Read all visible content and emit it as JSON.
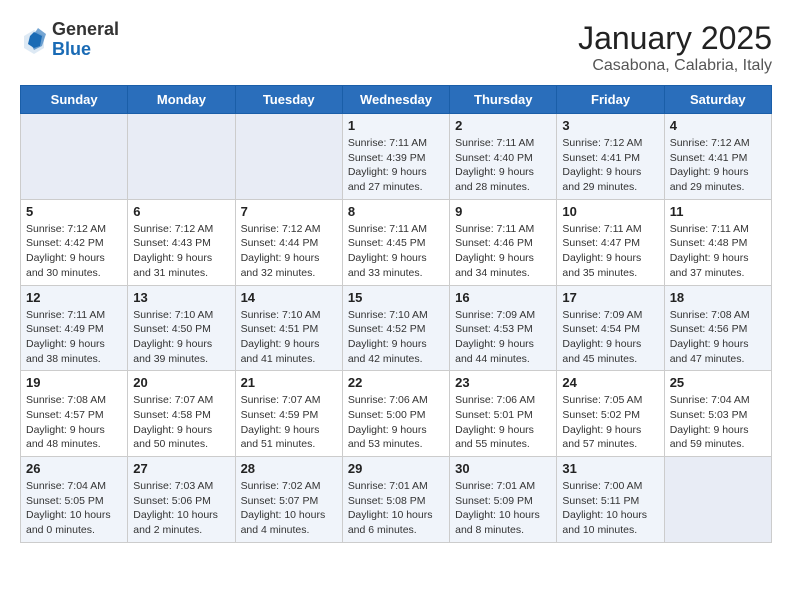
{
  "header": {
    "logo_general": "General",
    "logo_blue": "Blue",
    "month": "January 2025",
    "location": "Casabona, Calabria, Italy"
  },
  "weekdays": [
    "Sunday",
    "Monday",
    "Tuesday",
    "Wednesday",
    "Thursday",
    "Friday",
    "Saturday"
  ],
  "weeks": [
    [
      {
        "day": "",
        "info": ""
      },
      {
        "day": "",
        "info": ""
      },
      {
        "day": "",
        "info": ""
      },
      {
        "day": "1",
        "info": "Sunrise: 7:11 AM\nSunset: 4:39 PM\nDaylight: 9 hours\nand 27 minutes."
      },
      {
        "day": "2",
        "info": "Sunrise: 7:11 AM\nSunset: 4:40 PM\nDaylight: 9 hours\nand 28 minutes."
      },
      {
        "day": "3",
        "info": "Sunrise: 7:12 AM\nSunset: 4:41 PM\nDaylight: 9 hours\nand 29 minutes."
      },
      {
        "day": "4",
        "info": "Sunrise: 7:12 AM\nSunset: 4:41 PM\nDaylight: 9 hours\nand 29 minutes."
      }
    ],
    [
      {
        "day": "5",
        "info": "Sunrise: 7:12 AM\nSunset: 4:42 PM\nDaylight: 9 hours\nand 30 minutes."
      },
      {
        "day": "6",
        "info": "Sunrise: 7:12 AM\nSunset: 4:43 PM\nDaylight: 9 hours\nand 31 minutes."
      },
      {
        "day": "7",
        "info": "Sunrise: 7:12 AM\nSunset: 4:44 PM\nDaylight: 9 hours\nand 32 minutes."
      },
      {
        "day": "8",
        "info": "Sunrise: 7:11 AM\nSunset: 4:45 PM\nDaylight: 9 hours\nand 33 minutes."
      },
      {
        "day": "9",
        "info": "Sunrise: 7:11 AM\nSunset: 4:46 PM\nDaylight: 9 hours\nand 34 minutes."
      },
      {
        "day": "10",
        "info": "Sunrise: 7:11 AM\nSunset: 4:47 PM\nDaylight: 9 hours\nand 35 minutes."
      },
      {
        "day": "11",
        "info": "Sunrise: 7:11 AM\nSunset: 4:48 PM\nDaylight: 9 hours\nand 37 minutes."
      }
    ],
    [
      {
        "day": "12",
        "info": "Sunrise: 7:11 AM\nSunset: 4:49 PM\nDaylight: 9 hours\nand 38 minutes."
      },
      {
        "day": "13",
        "info": "Sunrise: 7:10 AM\nSunset: 4:50 PM\nDaylight: 9 hours\nand 39 minutes."
      },
      {
        "day": "14",
        "info": "Sunrise: 7:10 AM\nSunset: 4:51 PM\nDaylight: 9 hours\nand 41 minutes."
      },
      {
        "day": "15",
        "info": "Sunrise: 7:10 AM\nSunset: 4:52 PM\nDaylight: 9 hours\nand 42 minutes."
      },
      {
        "day": "16",
        "info": "Sunrise: 7:09 AM\nSunset: 4:53 PM\nDaylight: 9 hours\nand 44 minutes."
      },
      {
        "day": "17",
        "info": "Sunrise: 7:09 AM\nSunset: 4:54 PM\nDaylight: 9 hours\nand 45 minutes."
      },
      {
        "day": "18",
        "info": "Sunrise: 7:08 AM\nSunset: 4:56 PM\nDaylight: 9 hours\nand 47 minutes."
      }
    ],
    [
      {
        "day": "19",
        "info": "Sunrise: 7:08 AM\nSunset: 4:57 PM\nDaylight: 9 hours\nand 48 minutes."
      },
      {
        "day": "20",
        "info": "Sunrise: 7:07 AM\nSunset: 4:58 PM\nDaylight: 9 hours\nand 50 minutes."
      },
      {
        "day": "21",
        "info": "Sunrise: 7:07 AM\nSunset: 4:59 PM\nDaylight: 9 hours\nand 51 minutes."
      },
      {
        "day": "22",
        "info": "Sunrise: 7:06 AM\nSunset: 5:00 PM\nDaylight: 9 hours\nand 53 minutes."
      },
      {
        "day": "23",
        "info": "Sunrise: 7:06 AM\nSunset: 5:01 PM\nDaylight: 9 hours\nand 55 minutes."
      },
      {
        "day": "24",
        "info": "Sunrise: 7:05 AM\nSunset: 5:02 PM\nDaylight: 9 hours\nand 57 minutes."
      },
      {
        "day": "25",
        "info": "Sunrise: 7:04 AM\nSunset: 5:03 PM\nDaylight: 9 hours\nand 59 minutes."
      }
    ],
    [
      {
        "day": "26",
        "info": "Sunrise: 7:04 AM\nSunset: 5:05 PM\nDaylight: 10 hours\nand 0 minutes."
      },
      {
        "day": "27",
        "info": "Sunrise: 7:03 AM\nSunset: 5:06 PM\nDaylight: 10 hours\nand 2 minutes."
      },
      {
        "day": "28",
        "info": "Sunrise: 7:02 AM\nSunset: 5:07 PM\nDaylight: 10 hours\nand 4 minutes."
      },
      {
        "day": "29",
        "info": "Sunrise: 7:01 AM\nSunset: 5:08 PM\nDaylight: 10 hours\nand 6 minutes."
      },
      {
        "day": "30",
        "info": "Sunrise: 7:01 AM\nSunset: 5:09 PM\nDaylight: 10 hours\nand 8 minutes."
      },
      {
        "day": "31",
        "info": "Sunrise: 7:00 AM\nSunset: 5:11 PM\nDaylight: 10 hours\nand 10 minutes."
      },
      {
        "day": "",
        "info": ""
      }
    ]
  ]
}
